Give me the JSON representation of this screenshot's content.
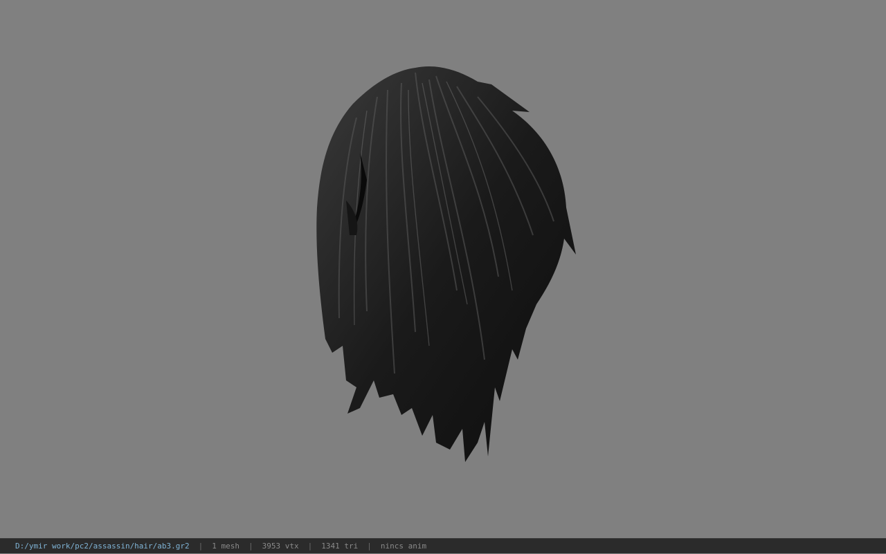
{
  "viewport": {
    "background_color": "#808080",
    "model_name": "hair-mesh",
    "model_color": "#1c1c1c"
  },
  "statusbar": {
    "file_path": "D:/ymir work/pc2/assassin/hair/ab3.gr2",
    "separator": "|",
    "mesh_count": "1 mesh",
    "vertex_count": "3953 vtx",
    "triangle_count": "1341 tri",
    "anim_status": "nincs anim",
    "path_color": "#7fb3d5",
    "text_color": "#8a8a8a",
    "background_color": "#2b2b2b"
  }
}
